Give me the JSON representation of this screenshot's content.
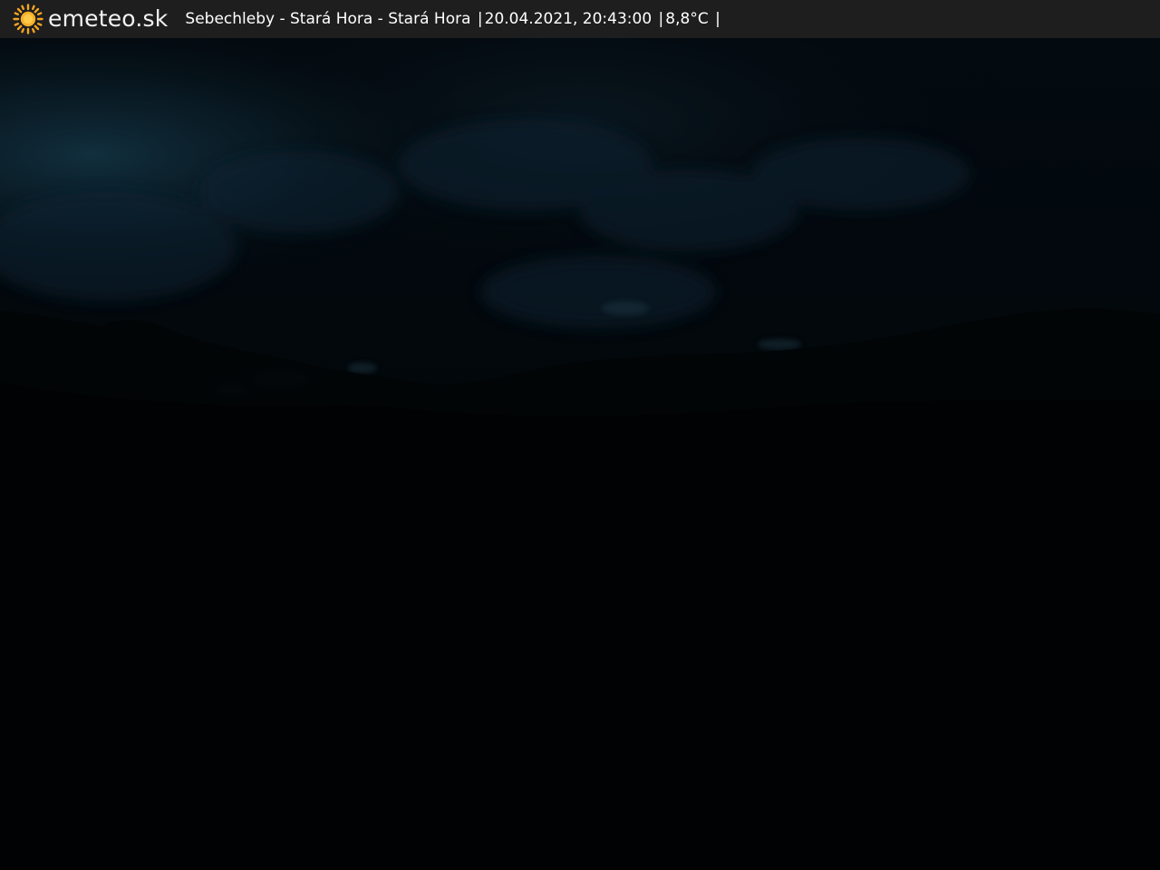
{
  "brand": {
    "name": "emeteo.sk",
    "icon": "sun-icon",
    "icon_color": "#f5a623"
  },
  "caption": {
    "location": "Sebechleby - Stará Hora - Stará Hora",
    "timestamp": "20.04.2021, 20:43:00",
    "temperature": "8,8°C",
    "separator": "|"
  },
  "colors": {
    "bar": "#1e1e1e",
    "sky_glow": "#0f2a38",
    "ground": "#010203"
  }
}
